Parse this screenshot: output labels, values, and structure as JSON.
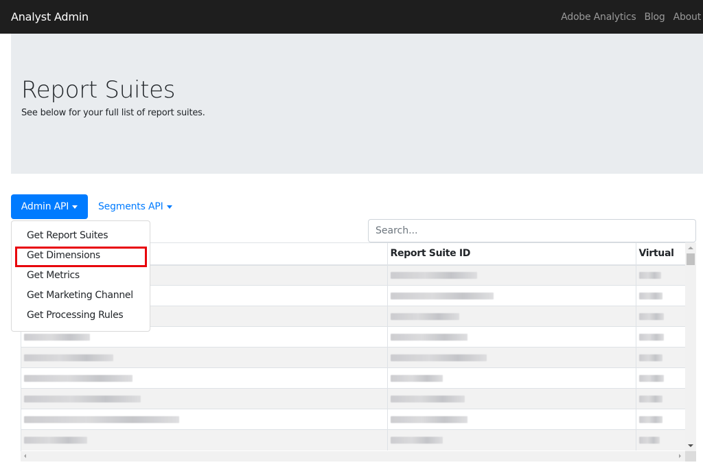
{
  "navbar": {
    "brand": "Analyst Admin",
    "links": [
      "Adobe Analytics",
      "Blog",
      "About"
    ]
  },
  "jumbotron": {
    "title": "Report Suites",
    "subtitle": "See below for your full list of report suites."
  },
  "toolbar": {
    "admin_api_label": "Admin API",
    "segments_api_label": "Segments API",
    "search_placeholder": "Search..."
  },
  "admin_menu": {
    "items": [
      "Get Report Suites",
      "Get Dimensions",
      "Get Metrics",
      "Get Marketing Channel",
      "Get Processing Rules"
    ],
    "highlighted_item": "Get Dimensions",
    "highlight_color": "#e8000a"
  },
  "table": {
    "columns": [
      "",
      "Report Suite ID",
      "Virtual"
    ],
    "rows_note": "cell values are pixelated/redacted in the screenshot",
    "row_count_visible": 9
  },
  "colors": {
    "navbar_bg": "#1e1e1e",
    "primary": "#007bff",
    "jumbotron_bg": "#e9ecef"
  }
}
